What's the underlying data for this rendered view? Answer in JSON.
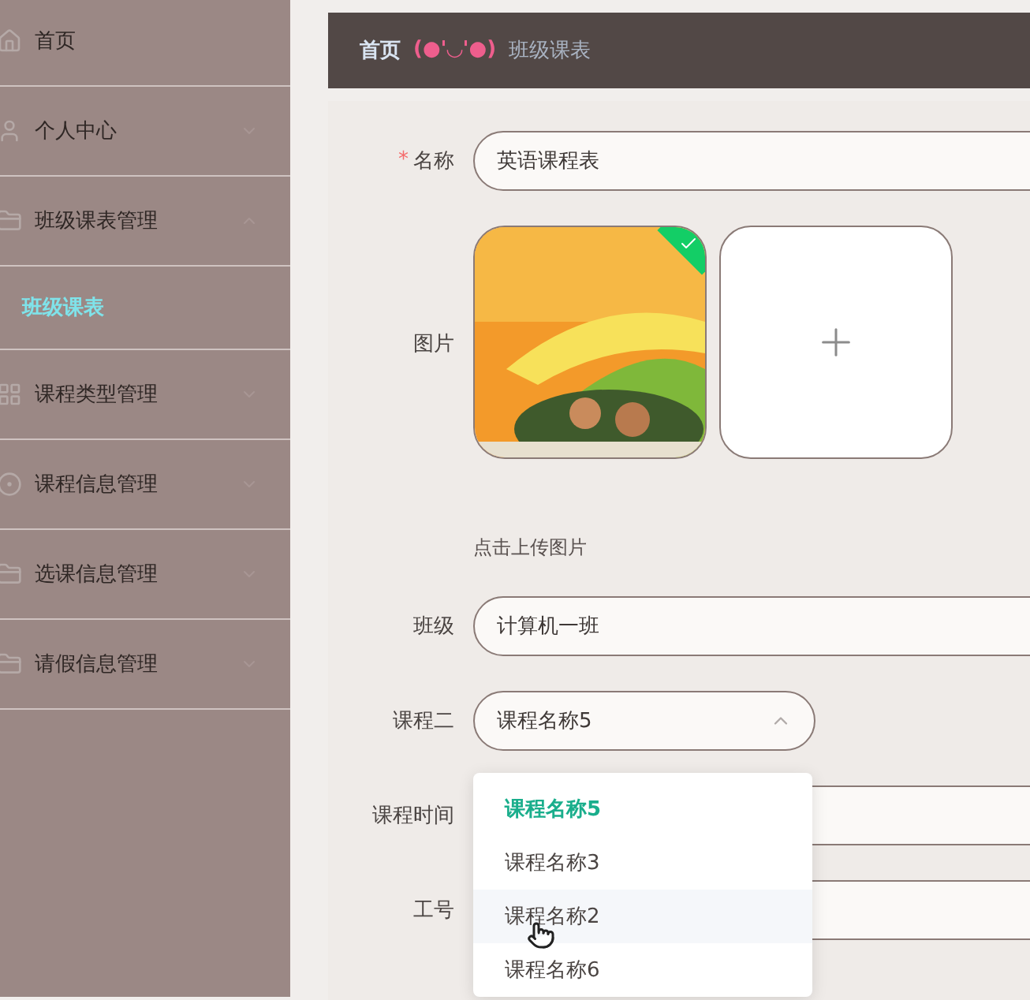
{
  "sidebar": {
    "items": [
      {
        "label": "首页"
      },
      {
        "label": "个人中心",
        "expanded": false
      },
      {
        "label": "班级课表管理",
        "expanded": true,
        "children": [
          {
            "label": "班级课表",
            "selected": true
          }
        ]
      },
      {
        "label": "课程类型管理",
        "expanded": false
      },
      {
        "label": "课程信息管理",
        "expanded": false
      },
      {
        "label": "选课信息管理",
        "expanded": false
      },
      {
        "label": "请假信息管理",
        "expanded": false
      }
    ]
  },
  "breadcrumb": [
    {
      "kind": "link",
      "text": "首页"
    },
    {
      "kind": "emoticon",
      "text": "(●'◡'●)"
    },
    {
      "kind": "current",
      "text": "班级课表"
    }
  ],
  "form": {
    "fields": [
      {
        "kind": "text",
        "label": "名称",
        "required_mark": "*",
        "value": "英语课程表"
      },
      {
        "kind": "upload",
        "label": "图片",
        "hint": "点击上传图片"
      },
      {
        "kind": "text",
        "label": "班级",
        "value": "计算机一班"
      },
      {
        "kind": "select",
        "label": "课程二",
        "value": "课程名称5",
        "open": true,
        "options": [
          {
            "label": "课程名称5",
            "selected": true,
            "hovered": false
          },
          {
            "label": "课程名称3",
            "selected": false,
            "hovered": false
          },
          {
            "label": "课程名称2",
            "selected": false,
            "hovered": true
          },
          {
            "label": "课程名称6",
            "selected": false,
            "hovered": false
          }
        ]
      },
      {
        "kind": "text",
        "label": "课程时间"
      },
      {
        "kind": "text",
        "label": "工号"
      }
    ]
  }
}
